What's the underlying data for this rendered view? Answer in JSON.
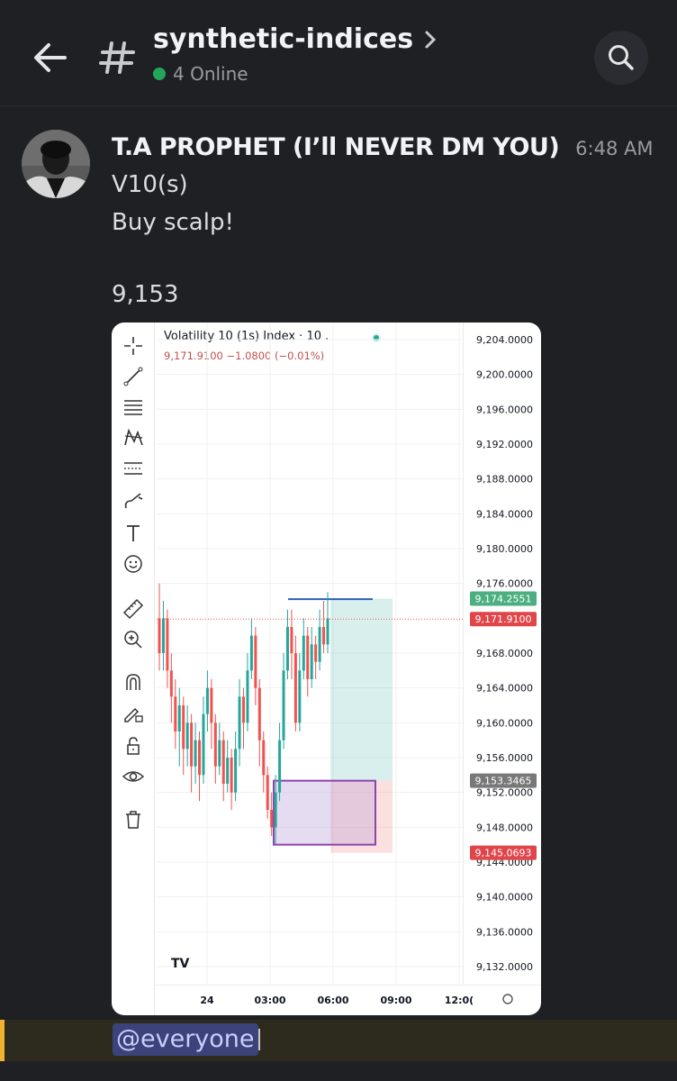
{
  "header": {
    "channel_name": "synthetic-indices",
    "online_text": "4 Online"
  },
  "message": {
    "author": "T.A PROPHET (I’ll NEVER DM YOU)",
    "time": "6:48 AM",
    "lines": [
      "V10(s)",
      "Buy scalp!",
      "9,153"
    ]
  },
  "chart_data": {
    "type": "candlestick",
    "title": "Volatility 10 (1s) Index · 10 .",
    "quote": "9,171.9100 −1.0800 (−0.01%)",
    "y_ticks": [
      "9,204.0000",
      "9,200.0000",
      "9,196.0000",
      "9,192.0000",
      "9,188.0000",
      "9,184.0000",
      "9,180.0000",
      "9,176.0000",
      "9,168.0000",
      "9,164.0000",
      "9,160.0000",
      "9,156.0000",
      "9,152.0000",
      "9,148.0000",
      "9,144.0000",
      "9,140.0000",
      "9,136.0000",
      "9,132.0000"
    ],
    "ylim": [
      9130,
      9206
    ],
    "x_ticks": [
      "24",
      "03:00",
      "06:00",
      "09:00",
      "12:0("
    ],
    "price_labels": [
      {
        "text": "9,174.2551",
        "color": "#4caf82",
        "value": 9174.2551
      },
      {
        "text": "9,171.9100",
        "color": "#e0454a",
        "value": 9171.91
      },
      {
        "text": "9,153.3465",
        "color": "#787878",
        "value": 9153.3465
      },
      {
        "text": "9,145.0693",
        "color": "#e0454a",
        "value": 9145.0693
      }
    ],
    "position": {
      "entry": 9153.3465,
      "target": 9174.2551,
      "stop": 9145.0693
    },
    "candles": [
      [
        9172,
        9168,
        9176,
        9166
      ],
      [
        9168,
        9172,
        9174,
        9166
      ],
      [
        9172,
        9166,
        9173,
        9164
      ],
      [
        9166,
        9163,
        9168,
        9160
      ],
      [
        9163,
        9159,
        9165,
        9157
      ],
      [
        9159,
        9162,
        9164,
        9155
      ],
      [
        9162,
        9157,
        9163,
        9154
      ],
      [
        9157,
        9160,
        9162,
        9155
      ],
      [
        9160,
        9155,
        9161,
        9152
      ],
      [
        9155,
        9158,
        9160,
        9153
      ],
      [
        9158,
        9154,
        9159,
        9151
      ],
      [
        9154,
        9161,
        9163,
        9153
      ],
      [
        9161,
        9164,
        9166,
        9159
      ],
      [
        9164,
        9160,
        9165,
        9157
      ],
      [
        9160,
        9155,
        9161,
        9153
      ],
      [
        9155,
        9158,
        9160,
        9154
      ],
      [
        9158,
        9153,
        9159,
        9151
      ],
      [
        9153,
        9156,
        9158,
        9152
      ],
      [
        9156,
        9152,
        9157,
        9150
      ],
      [
        9152,
        9157,
        9159,
        9151
      ],
      [
        9157,
        9163,
        9165,
        9155
      ],
      [
        9163,
        9160,
        9164,
        9157
      ],
      [
        9160,
        9166,
        9168,
        9159
      ],
      [
        9166,
        9170,
        9172,
        9165
      ],
      [
        9170,
        9164,
        9171,
        9162
      ],
      [
        9164,
        9158,
        9165,
        9155
      ],
      [
        9158,
        9154,
        9159,
        9152
      ],
      [
        9154,
        9150,
        9155,
        9149
      ],
      [
        9150,
        9148,
        9152,
        9147
      ],
      [
        9148,
        9152,
        9154,
        9146
      ],
      [
        9152,
        9158,
        9160,
        9151
      ],
      [
        9158,
        9166,
        9168,
        9157
      ],
      [
        9166,
        9171,
        9173,
        9165
      ],
      [
        9171,
        9168,
        9173,
        9165
      ],
      [
        9168,
        9160,
        9170,
        9159
      ],
      [
        9160,
        9166,
        9168,
        9159
      ],
      [
        9166,
        9170,
        9172,
        9165
      ],
      [
        9170,
        9165,
        9171,
        9163
      ],
      [
        9165,
        9169,
        9171,
        9164
      ],
      [
        9169,
        9167,
        9170,
        9165
      ],
      [
        9167,
        9171,
        9173,
        9166
      ],
      [
        9171,
        9169,
        9174,
        9168
      ],
      [
        9169,
        9172,
        9175,
        9168
      ]
    ]
  }
}
